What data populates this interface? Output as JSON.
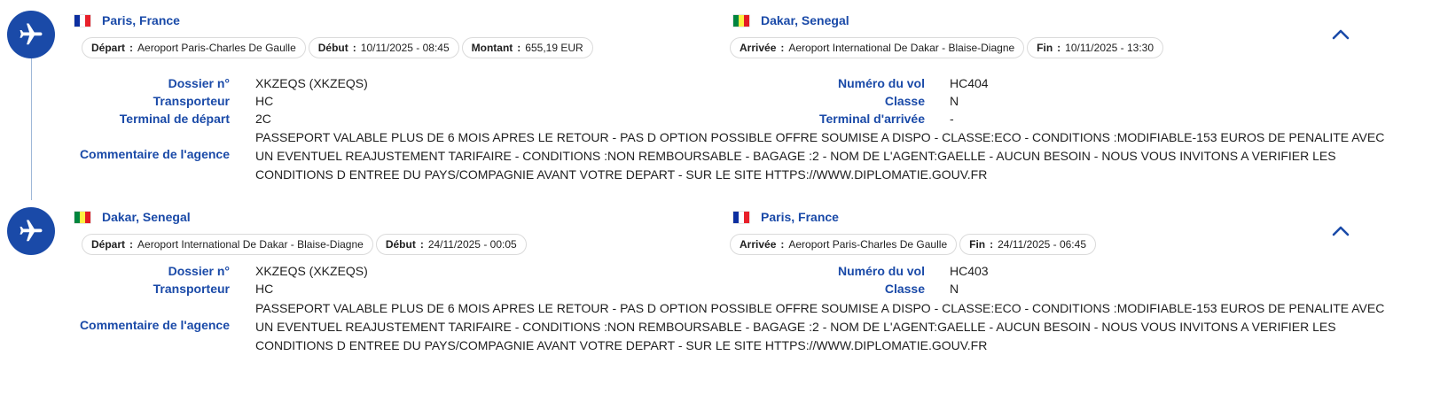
{
  "flags": {
    "france": [
      "#0d2fa0",
      "#ffffff",
      "#e8202a"
    ],
    "senegal": [
      "#00853f",
      "#fdef42",
      "#e31b23"
    ]
  },
  "colors": {
    "accent": "#1a4aa8"
  },
  "icons": {
    "plane": "airplane-icon",
    "collapse": "chevron-up-icon"
  },
  "legs": [
    {
      "from": {
        "city": "Paris, France",
        "flag": "france"
      },
      "to": {
        "city": "Dakar, Senegal",
        "flag": "senegal"
      },
      "chips_from": [
        {
          "label": "Départ",
          "value": "Aeroport Paris-Charles De Gaulle"
        },
        {
          "label": "Début",
          "value": "10/11/2025 - 08:45"
        },
        {
          "label": "Montant",
          "value": "655,19 EUR"
        }
      ],
      "chips_to": [
        {
          "label": "Arrivée",
          "value": "Aeroport International De Dakar - Blaise-Diagne"
        },
        {
          "label": "Fin",
          "value": "10/11/2025 - 13:30"
        }
      ],
      "chip_separator": ":",
      "details": {
        "dossier_label": "Dossier n°",
        "dossier": "XKZEQS (XKZEQS)",
        "transporteur_label": "Transporteur",
        "transporteur": "HC",
        "terminal_depart_label": "Terminal de départ",
        "terminal_depart": "2C",
        "vol_label": "Numéro du vol",
        "vol": "HC404",
        "classe_label": "Classe",
        "classe": "N",
        "terminal_arrivee_label": "Terminal d'arrivée",
        "terminal_arrivee": "-",
        "commentaire_label": "Commentaire de l'agence",
        "commentaire": "PASSEPORT VALABLE PLUS DE 6 MOIS APRES LE RETOUR - PAS D OPTION POSSIBLE OFFRE SOUMISE A DISPO - CLASSE:ECO - CONDITIONS :MODIFIABLE-153 EUROS DE PENALITE AVEC UN EVENTUEL REAJUSTEMENT TARIFAIRE - CONDITIONS :NON REMBOURSABLE - BAGAGE :2 - NOM DE L'AGENT:GAELLE - AUCUN BESOIN - NOUS VOUS INVITONS A VERIFIER LES CONDITIONS D ENTREE DU PAYS/COMPAGNIE AVANT VOTRE DEPART - SUR LE SITE HTTPS://WWW.DIPLOMATIE.GOUV.FR"
      }
    },
    {
      "from": {
        "city": "Dakar, Senegal",
        "flag": "senegal"
      },
      "to": {
        "city": "Paris, France",
        "flag": "france"
      },
      "chips_from": [
        {
          "label": "Départ",
          "value": "Aeroport International De Dakar - Blaise-Diagne"
        },
        {
          "label": "Début",
          "value": "24/11/2025 - 00:05"
        }
      ],
      "chips_to": [
        {
          "label": "Arrivée",
          "value": "Aeroport Paris-Charles De Gaulle"
        },
        {
          "label": "Fin",
          "value": "24/11/2025 - 06:45"
        }
      ],
      "chip_separator": ":",
      "details": {
        "dossier_label": "Dossier n°",
        "dossier": "XKZEQS (XKZEQS)",
        "transporteur_label": "Transporteur",
        "transporteur": "HC",
        "vol_label": "Numéro du vol",
        "vol": "HC403",
        "classe_label": "Classe",
        "classe": "N",
        "commentaire_label": "Commentaire de l'agence",
        "commentaire": "PASSEPORT VALABLE PLUS DE 6 MOIS APRES LE RETOUR - PAS D OPTION POSSIBLE OFFRE SOUMISE A DISPO - CLASSE:ECO - CONDITIONS :MODIFIABLE-153 EUROS DE PENALITE AVEC UN EVENTUEL REAJUSTEMENT TARIFAIRE - CONDITIONS :NON REMBOURSABLE - BAGAGE :2 - NOM DE L'AGENT:GAELLE - AUCUN BESOIN - NOUS VOUS INVITONS A VERIFIER LES CONDITIONS D ENTREE DU PAYS/COMPAGNIE AVANT VOTRE DEPART - SUR LE SITE HTTPS://WWW.DIPLOMATIE.GOUV.FR"
      }
    }
  ]
}
